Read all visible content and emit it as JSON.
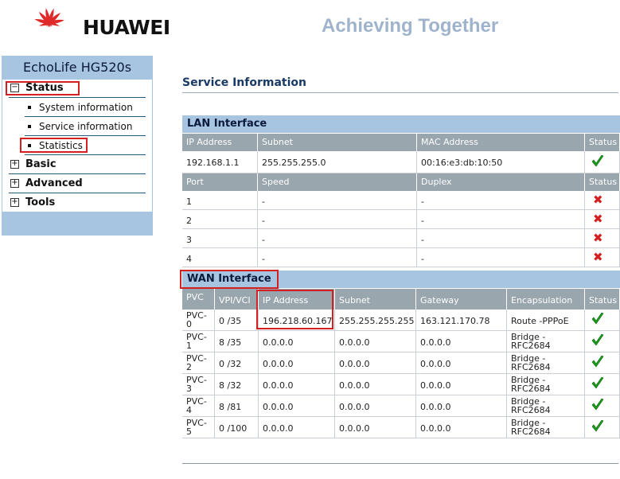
{
  "header": {
    "brand": "HUAWEI",
    "tagline": "Achieving Together",
    "logo_icon": "huawei-petal-logo",
    "logo_color": "#e02a2a"
  },
  "sidebar": {
    "title": "EchoLife HG520s",
    "items": [
      {
        "label": "Status",
        "expanded": true
      },
      {
        "label": "System information"
      },
      {
        "label": "Service information"
      },
      {
        "label": "Statistics"
      },
      {
        "label": "Basic",
        "expanded": false
      },
      {
        "label": "Advanced",
        "expanded": false
      },
      {
        "label": "Tools",
        "expanded": false
      }
    ],
    "collapse_symbol": "−",
    "expand_symbol": "+"
  },
  "main": {
    "title": "Service Information",
    "lan": {
      "section_title": "LAN Interface",
      "headers": [
        "IP Address",
        "Subnet",
        "MAC Address",
        "Status"
      ],
      "row": {
        "ip": "192.168.1.1",
        "subnet": "255.255.255.0",
        "mac": "00:16:e3:db:10:50",
        "status": "ok"
      },
      "port_headers": [
        "Port",
        "Speed",
        "Duplex",
        "Status"
      ],
      "ports": [
        {
          "port": "1",
          "speed": "-",
          "duplex": "-",
          "status": "down"
        },
        {
          "port": "2",
          "speed": "-",
          "duplex": "-",
          "status": "down"
        },
        {
          "port": "3",
          "speed": "-",
          "duplex": "-",
          "status": "down"
        },
        {
          "port": "4",
          "speed": "-",
          "duplex": "-",
          "status": "down"
        }
      ]
    },
    "wan": {
      "section_title": "WAN Interface",
      "headers": [
        "PVC",
        "VPI/VCI",
        "IP Address",
        "Subnet",
        "Gateway",
        "Encapsulation",
        "Status"
      ],
      "rows": [
        {
          "pvc": "PVC-0",
          "vpivci": "0 /35",
          "ip": "196.218.60.167",
          "subnet": "255.255.255.255",
          "gateway": "163.121.170.78",
          "encap": "Route -PPPoE",
          "status": "ok"
        },
        {
          "pvc": "PVC-1",
          "vpivci": "8 /35",
          "ip": "0.0.0.0",
          "subnet": "0.0.0.0",
          "gateway": "0.0.0.0",
          "encap": "Bridge - RFC2684",
          "status": "ok"
        },
        {
          "pvc": "PVC-2",
          "vpivci": "0 /32",
          "ip": "0.0.0.0",
          "subnet": "0.0.0.0",
          "gateway": "0.0.0.0",
          "encap": "Bridge - RFC2684",
          "status": "ok"
        },
        {
          "pvc": "PVC-3",
          "vpivci": "8 /32",
          "ip": "0.0.0.0",
          "subnet": "0.0.0.0",
          "gateway": "0.0.0.0",
          "encap": "Bridge - RFC2684",
          "status": "ok"
        },
        {
          "pvc": "PVC-4",
          "vpivci": "8 /81",
          "ip": "0.0.0.0",
          "subnet": "0.0.0.0",
          "gateway": "0.0.0.0",
          "encap": "Bridge - RFC2684",
          "status": "ok"
        },
        {
          "pvc": "PVC-5",
          "vpivci": "0 /100",
          "ip": "0.0.0.0",
          "subnet": "0.0.0.0",
          "gateway": "0.0.0.0",
          "encap": "Bridge - RFC2684",
          "status": "ok"
        }
      ]
    }
  },
  "colors": {
    "header_blue": "#a7c4e0",
    "column_header_gray": "#9aa6ae",
    "ok_green": "#1e9a1e",
    "down_red": "#d42020",
    "highlight_red": "#d42020"
  }
}
